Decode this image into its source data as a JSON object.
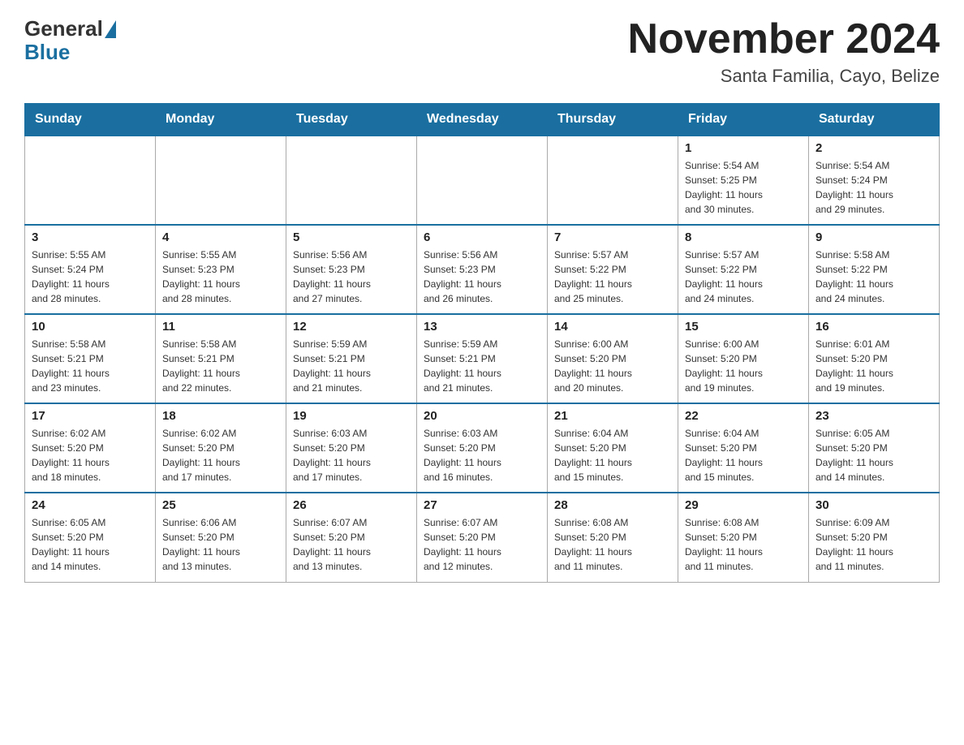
{
  "logo": {
    "general": "General",
    "blue": "Blue"
  },
  "header": {
    "month_year": "November 2024",
    "location": "Santa Familia, Cayo, Belize"
  },
  "days_of_week": [
    "Sunday",
    "Monday",
    "Tuesday",
    "Wednesday",
    "Thursday",
    "Friday",
    "Saturday"
  ],
  "weeks": [
    [
      {
        "day": "",
        "info": ""
      },
      {
        "day": "",
        "info": ""
      },
      {
        "day": "",
        "info": ""
      },
      {
        "day": "",
        "info": ""
      },
      {
        "day": "",
        "info": ""
      },
      {
        "day": "1",
        "info": "Sunrise: 5:54 AM\nSunset: 5:25 PM\nDaylight: 11 hours\nand 30 minutes."
      },
      {
        "day": "2",
        "info": "Sunrise: 5:54 AM\nSunset: 5:24 PM\nDaylight: 11 hours\nand 29 minutes."
      }
    ],
    [
      {
        "day": "3",
        "info": "Sunrise: 5:55 AM\nSunset: 5:24 PM\nDaylight: 11 hours\nand 28 minutes."
      },
      {
        "day": "4",
        "info": "Sunrise: 5:55 AM\nSunset: 5:23 PM\nDaylight: 11 hours\nand 28 minutes."
      },
      {
        "day": "5",
        "info": "Sunrise: 5:56 AM\nSunset: 5:23 PM\nDaylight: 11 hours\nand 27 minutes."
      },
      {
        "day": "6",
        "info": "Sunrise: 5:56 AM\nSunset: 5:23 PM\nDaylight: 11 hours\nand 26 minutes."
      },
      {
        "day": "7",
        "info": "Sunrise: 5:57 AM\nSunset: 5:22 PM\nDaylight: 11 hours\nand 25 minutes."
      },
      {
        "day": "8",
        "info": "Sunrise: 5:57 AM\nSunset: 5:22 PM\nDaylight: 11 hours\nand 24 minutes."
      },
      {
        "day": "9",
        "info": "Sunrise: 5:58 AM\nSunset: 5:22 PM\nDaylight: 11 hours\nand 24 minutes."
      }
    ],
    [
      {
        "day": "10",
        "info": "Sunrise: 5:58 AM\nSunset: 5:21 PM\nDaylight: 11 hours\nand 23 minutes."
      },
      {
        "day": "11",
        "info": "Sunrise: 5:58 AM\nSunset: 5:21 PM\nDaylight: 11 hours\nand 22 minutes."
      },
      {
        "day": "12",
        "info": "Sunrise: 5:59 AM\nSunset: 5:21 PM\nDaylight: 11 hours\nand 21 minutes."
      },
      {
        "day": "13",
        "info": "Sunrise: 5:59 AM\nSunset: 5:21 PM\nDaylight: 11 hours\nand 21 minutes."
      },
      {
        "day": "14",
        "info": "Sunrise: 6:00 AM\nSunset: 5:20 PM\nDaylight: 11 hours\nand 20 minutes."
      },
      {
        "day": "15",
        "info": "Sunrise: 6:00 AM\nSunset: 5:20 PM\nDaylight: 11 hours\nand 19 minutes."
      },
      {
        "day": "16",
        "info": "Sunrise: 6:01 AM\nSunset: 5:20 PM\nDaylight: 11 hours\nand 19 minutes."
      }
    ],
    [
      {
        "day": "17",
        "info": "Sunrise: 6:02 AM\nSunset: 5:20 PM\nDaylight: 11 hours\nand 18 minutes."
      },
      {
        "day": "18",
        "info": "Sunrise: 6:02 AM\nSunset: 5:20 PM\nDaylight: 11 hours\nand 17 minutes."
      },
      {
        "day": "19",
        "info": "Sunrise: 6:03 AM\nSunset: 5:20 PM\nDaylight: 11 hours\nand 17 minutes."
      },
      {
        "day": "20",
        "info": "Sunrise: 6:03 AM\nSunset: 5:20 PM\nDaylight: 11 hours\nand 16 minutes."
      },
      {
        "day": "21",
        "info": "Sunrise: 6:04 AM\nSunset: 5:20 PM\nDaylight: 11 hours\nand 15 minutes."
      },
      {
        "day": "22",
        "info": "Sunrise: 6:04 AM\nSunset: 5:20 PM\nDaylight: 11 hours\nand 15 minutes."
      },
      {
        "day": "23",
        "info": "Sunrise: 6:05 AM\nSunset: 5:20 PM\nDaylight: 11 hours\nand 14 minutes."
      }
    ],
    [
      {
        "day": "24",
        "info": "Sunrise: 6:05 AM\nSunset: 5:20 PM\nDaylight: 11 hours\nand 14 minutes."
      },
      {
        "day": "25",
        "info": "Sunrise: 6:06 AM\nSunset: 5:20 PM\nDaylight: 11 hours\nand 13 minutes."
      },
      {
        "day": "26",
        "info": "Sunrise: 6:07 AM\nSunset: 5:20 PM\nDaylight: 11 hours\nand 13 minutes."
      },
      {
        "day": "27",
        "info": "Sunrise: 6:07 AM\nSunset: 5:20 PM\nDaylight: 11 hours\nand 12 minutes."
      },
      {
        "day": "28",
        "info": "Sunrise: 6:08 AM\nSunset: 5:20 PM\nDaylight: 11 hours\nand 11 minutes."
      },
      {
        "day": "29",
        "info": "Sunrise: 6:08 AM\nSunset: 5:20 PM\nDaylight: 11 hours\nand 11 minutes."
      },
      {
        "day": "30",
        "info": "Sunrise: 6:09 AM\nSunset: 5:20 PM\nDaylight: 11 hours\nand 11 minutes."
      }
    ]
  ]
}
